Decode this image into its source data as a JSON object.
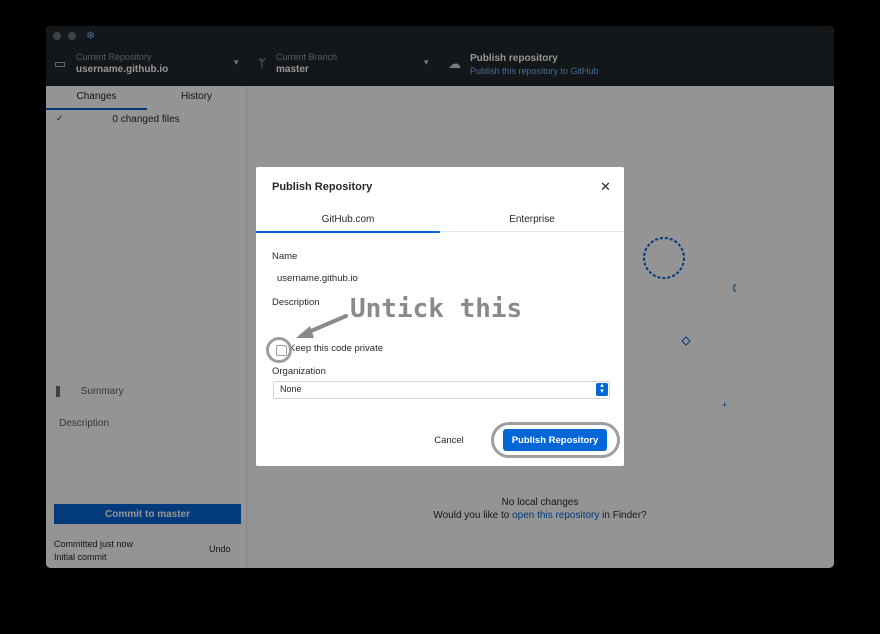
{
  "titlebar": {
    "repo_caption": "Current Repository",
    "repo_name": "username.github.io",
    "branch_caption": "Current Branch",
    "branch_name": "master",
    "publish_title": "Publish repository",
    "publish_sub": "Publish this repository to GitHub"
  },
  "sidebar": {
    "tabs": [
      {
        "label": "Changes",
        "active": true
      },
      {
        "label": "History",
        "active": false
      }
    ],
    "changed_files": "0 changed files",
    "check": "✓",
    "summary_placeholder": "Summary",
    "description_placeholder": "Description",
    "commit_button": "Commit to master",
    "last_commit_time": "Committed just now",
    "last_commit_msg": "Initial commit",
    "undo": "Undo"
  },
  "main": {
    "no_changes": "No local changes",
    "prompt_prefix": "Would you like to ",
    "prompt_link": "open this repository",
    "prompt_suffix": " in Finder?"
  },
  "modal": {
    "title": "Publish Repository",
    "close": "✕",
    "tabs": [
      {
        "label": "GitHub.com",
        "active": true
      },
      {
        "label": "Enterprise",
        "active": false
      }
    ],
    "name_label": "Name",
    "name_value": "username.github.io",
    "description_label": "Description",
    "description_value": "",
    "private_label": "Keep this code private",
    "private_checked": false,
    "organization_label": "Organization",
    "organization_value": "None",
    "cancel": "Cancel",
    "publish": "Publish Repository"
  },
  "annotation": {
    "text": "Untick this",
    "color": "#8a8a8a"
  },
  "colors": {
    "accent": "#0366d6",
    "titlebar": "#24292e"
  }
}
